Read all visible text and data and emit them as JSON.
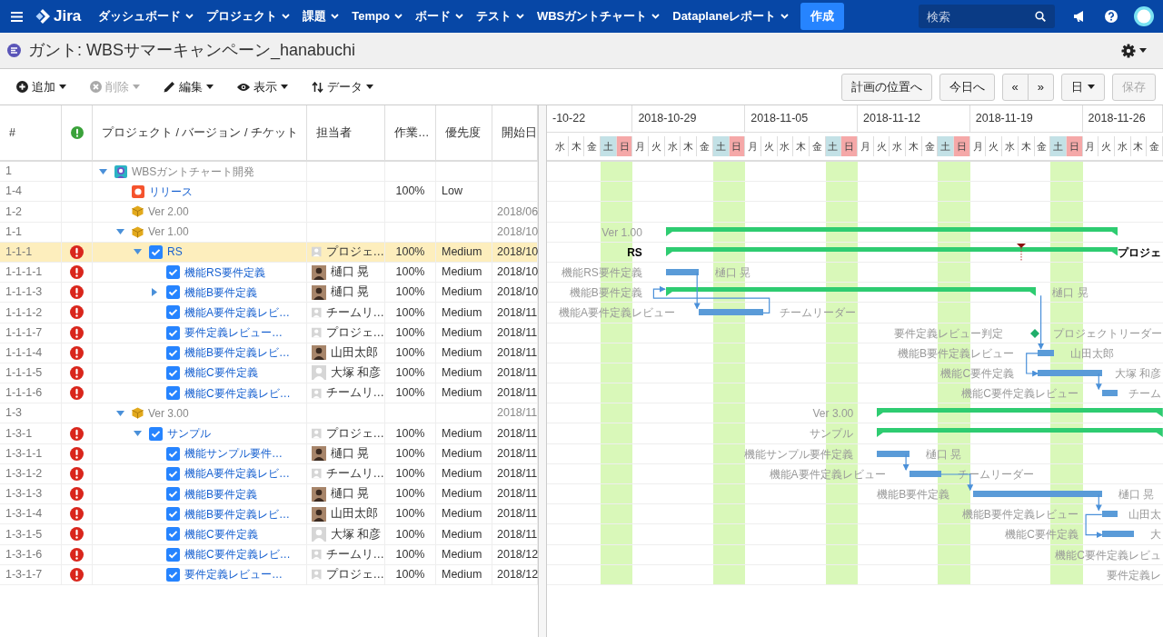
{
  "nav": {
    "app_name": "Jira",
    "menus": [
      {
        "label": "ダッシュボード"
      },
      {
        "label": "プロジェクト"
      },
      {
        "label": "課題"
      },
      {
        "label": "Tempo"
      },
      {
        "label": "ボード"
      },
      {
        "label": "テスト"
      },
      {
        "label": "WBSガントチャート"
      },
      {
        "label": "Dataplaneレポート"
      }
    ],
    "create_button": "作成",
    "search": {
      "placeholder": "検索"
    }
  },
  "page_title": "ガント: WBSサマーキャンペーン_hanabuchi",
  "toolbar": {
    "left": [
      {
        "label": "追加",
        "disabled": false
      },
      {
        "label": "削除",
        "disabled": true
      },
      {
        "label": "編集",
        "disabled": false
      },
      {
        "label": "表示",
        "disabled": false
      },
      {
        "label": "データ",
        "disabled": false
      }
    ],
    "right": [
      {
        "kind": "button",
        "label": "計画の位置へ",
        "disabled": false
      },
      {
        "kind": "button",
        "label": "今日へ",
        "disabled": false
      },
      {
        "kind": "pair",
        "labels": [
          "«",
          "»"
        ]
      },
      {
        "kind": "dropdown",
        "label": "日"
      },
      {
        "kind": "button",
        "label": "保存",
        "disabled": true
      }
    ]
  },
  "table": {
    "columns": [
      {
        "kind": "text",
        "label": "#"
      },
      {
        "kind": "alert"
      },
      {
        "kind": "text",
        "label": "プロジェクト / バージョン / チケット"
      },
      {
        "kind": "text",
        "label": "担当者"
      },
      {
        "kind": "text",
        "label": "作業…"
      },
      {
        "kind": "text",
        "label": "優先度"
      },
      {
        "kind": "text",
        "label": "開始日"
      }
    ],
    "rows": [
      {
        "id": "1",
        "kind": "project",
        "name": "WBSガントチャート開発",
        "alert": false,
        "selected": false,
        "expanded": true,
        "children": [
          {
            "id": "1-4",
            "kind": "release",
            "name": "リリース",
            "alert": false,
            "selected": false,
            "progress": "100%",
            "priority": "Low"
          },
          {
            "id": "1-2",
            "kind": "version",
            "name": "Ver 2.00",
            "alert": false,
            "selected": false,
            "start": "2018/06"
          },
          {
            "id": "1-1",
            "kind": "version",
            "name": "Ver 1.00",
            "alert": false,
            "selected": false,
            "start": "2018/10",
            "expanded": true,
            "gantt": {
              "label": "Ver 1.00",
              "kind": "summary"
            },
            "children": [
              {
                "id": "1-1-1",
                "kind": "task",
                "name": "RS",
                "alert": true,
                "selected": true,
                "expanded": true,
                "assignee": {
                  "name": "プロジェ…",
                  "kind": "default"
                },
                "progress": "100%",
                "priority": "Medium",
                "start": "2018/10",
                "gantt": {
                  "label": "RS",
                  "kind": "summary",
                  "assignee": "プロジェ",
                  "due_marker": true
                },
                "children": [
                  {
                    "id": "1-1-1-1",
                    "kind": "task",
                    "name": "機能RS要件定義",
                    "alert": true,
                    "selected": false,
                    "assignee": {
                      "name": "樋口 晃",
                      "kind": "photo"
                    },
                    "progress": "100%",
                    "priority": "Medium",
                    "start": "2018/10",
                    "gantt": {
                      "label": "機能RS要件定義",
                      "kind": "task",
                      "assignee": "樋口 晃"
                    }
                  },
                  {
                    "id": "1-1-1-3",
                    "kind": "task",
                    "name": "機能B要件定義",
                    "alert": true,
                    "selected": false,
                    "expanded": false,
                    "assignee": {
                      "name": "樋口 晃",
                      "kind": "photo"
                    },
                    "progress": "100%",
                    "priority": "Medium",
                    "start": "2018/10",
                    "gantt": {
                      "label": "機能B要件定義",
                      "kind": "summary",
                      "assignee": "樋口 晃"
                    }
                  },
                  {
                    "id": "1-1-1-2",
                    "kind": "task",
                    "name": "機能A要件定義レビ…",
                    "alert": true,
                    "selected": false,
                    "assignee": {
                      "name": "チームリ…",
                      "kind": "default"
                    },
                    "progress": "100%",
                    "priority": "Medium",
                    "start": "2018/11",
                    "gantt": {
                      "label": "機能A要件定義レビュー",
                      "kind": "task",
                      "assignee": "チームリーダー"
                    }
                  },
                  {
                    "id": "1-1-1-7",
                    "kind": "task",
                    "name": "要件定義レビュー…",
                    "alert": true,
                    "selected": false,
                    "assignee": {
                      "name": "プロジェ…",
                      "kind": "default"
                    },
                    "progress": "100%",
                    "priority": "Medium",
                    "start": "2018/11",
                    "gantt": {
                      "label": "要件定義レビュー判定",
                      "kind": "milestone",
                      "assignee": "プロジェクトリーダー"
                    }
                  },
                  {
                    "id": "1-1-1-4",
                    "kind": "task",
                    "name": "機能B要件定義レビ…",
                    "alert": true,
                    "selected": false,
                    "assignee": {
                      "name": "山田太郎",
                      "kind": "photo"
                    },
                    "progress": "100%",
                    "priority": "Medium",
                    "start": "2018/11",
                    "gantt": {
                      "label": "機能B要件定義レビュー",
                      "kind": "task",
                      "assignee": "山田太郎"
                    }
                  },
                  {
                    "id": "1-1-1-5",
                    "kind": "task",
                    "name": "機能C要件定義",
                    "alert": true,
                    "selected": false,
                    "assignee": {
                      "name": "大塚 和彦",
                      "kind": "default"
                    },
                    "progress": "100%",
                    "priority": "Medium",
                    "start": "2018/11",
                    "gantt": {
                      "label": "機能C要件定義",
                      "kind": "task",
                      "assignee": "大塚 和彦"
                    }
                  },
                  {
                    "id": "1-1-1-6",
                    "kind": "task",
                    "name": "機能C要件定義レビ…",
                    "alert": true,
                    "selected": false,
                    "assignee": {
                      "name": "チームリ…",
                      "kind": "default"
                    },
                    "progress": "100%",
                    "priority": "Medium",
                    "start": "2018/11",
                    "gantt": {
                      "label": "機能C要件定義レビュー",
                      "kind": "task",
                      "assignee": "チーム"
                    }
                  }
                ]
              }
            ]
          },
          {
            "id": "1-3",
            "kind": "version",
            "name": "Ver 3.00",
            "alert": false,
            "selected": false,
            "start": "2018/11",
            "expanded": true,
            "gantt": {
              "label": "Ver 3.00",
              "kind": "summary"
            },
            "children": [
              {
                "id": "1-3-1",
                "kind": "task",
                "name": "サンプル",
                "alert": true,
                "selected": false,
                "expanded": true,
                "assignee": {
                  "name": "プロジェ…",
                  "kind": "default"
                },
                "progress": "100%",
                "priority": "Medium",
                "start": "2018/11",
                "gantt": {
                  "label": "サンプル",
                  "kind": "summary"
                },
                "children": [
                  {
                    "id": "1-3-1-1",
                    "kind": "task",
                    "name": "機能サンプル要件…",
                    "alert": true,
                    "selected": false,
                    "assignee": {
                      "name": "樋口 晃",
                      "kind": "photo"
                    },
                    "progress": "100%",
                    "priority": "Medium",
                    "start": "2018/11",
                    "gantt": {
                      "label": "機能サンプル要件定義",
                      "kind": "task",
                      "assignee": "樋口 晃"
                    }
                  },
                  {
                    "id": "1-3-1-2",
                    "kind": "task",
                    "name": "機能A要件定義レビ…",
                    "alert": true,
                    "selected": false,
                    "assignee": {
                      "name": "チームリ…",
                      "kind": "default"
                    },
                    "progress": "100%",
                    "priority": "Medium",
                    "start": "2018/11",
                    "gantt": {
                      "label": "機能A要件定義レビュー",
                      "kind": "task",
                      "assignee": "チームリーダー"
                    }
                  },
                  {
                    "id": "1-3-1-3",
                    "kind": "task",
                    "name": "機能B要件定義",
                    "alert": true,
                    "selected": false,
                    "assignee": {
                      "name": "樋口 晃",
                      "kind": "photo"
                    },
                    "progress": "100%",
                    "priority": "Medium",
                    "start": "2018/11",
                    "gantt": {
                      "label": "機能B要件定義",
                      "kind": "task",
                      "assignee": "樋口 晃"
                    }
                  },
                  {
                    "id": "1-3-1-4",
                    "kind": "task",
                    "name": "機能B要件定義レビ…",
                    "alert": true,
                    "selected": false,
                    "assignee": {
                      "name": "山田太郎",
                      "kind": "photo"
                    },
                    "progress": "100%",
                    "priority": "Medium",
                    "start": "2018/11",
                    "gantt": {
                      "label": "機能B要件定義レビュー",
                      "kind": "task",
                      "assignee": "山田太"
                    }
                  },
                  {
                    "id": "1-3-1-5",
                    "kind": "task",
                    "name": "機能C要件定義",
                    "alert": true,
                    "selected": false,
                    "assignee": {
                      "name": "大塚 和彦",
                      "kind": "default"
                    },
                    "progress": "100%",
                    "priority": "Medium",
                    "start": "2018/11",
                    "gantt": {
                      "label": "機能C要件定義",
                      "kind": "task",
                      "assignee": "大"
                    }
                  },
                  {
                    "id": "1-3-1-6",
                    "kind": "task",
                    "name": "機能C要件定義レビ…",
                    "alert": true,
                    "selected": false,
                    "assignee": {
                      "name": "チームリ…",
                      "kind": "default"
                    },
                    "progress": "100%",
                    "priority": "Medium",
                    "start": "2018/12",
                    "gantt": {
                      "label": "機能C要件定義レビュ"
                    }
                  },
                  {
                    "id": "1-3-1-7",
                    "kind": "task",
                    "name": "要件定義レビュー…",
                    "alert": true,
                    "selected": false,
                    "assignee": {
                      "name": "プロジェ…",
                      "kind": "default"
                    },
                    "progress": "100%",
                    "priority": "Medium",
                    "start": "2018/12",
                    "gantt": {
                      "label": "要件定義レ"
                    }
                  }
                ]
              }
            ]
          }
        ]
      }
    ]
  },
  "gantt": {
    "weeks": [
      {
        "label": "-10-22",
        "days": [
          {
            "label": "水",
            "kind": "weekday"
          },
          {
            "label": "木",
            "kind": "weekday"
          },
          {
            "label": "金",
            "kind": "weekday"
          },
          {
            "label": "土",
            "kind": "sat"
          },
          {
            "label": "日",
            "kind": "sun"
          }
        ]
      },
      {
        "label": "2018-10-29",
        "days": [
          {
            "label": "月",
            "kind": "weekday"
          },
          {
            "label": "火",
            "kind": "weekday"
          },
          {
            "label": "水",
            "kind": "weekday"
          },
          {
            "label": "木",
            "kind": "weekday"
          },
          {
            "label": "金",
            "kind": "weekday"
          },
          {
            "label": "土",
            "kind": "sat"
          },
          {
            "label": "日",
            "kind": "sun"
          }
        ]
      },
      {
        "label": "2018-11-05",
        "days": [
          {
            "label": "月",
            "kind": "weekday"
          },
          {
            "label": "火",
            "kind": "weekday"
          },
          {
            "label": "水",
            "kind": "weekday"
          },
          {
            "label": "木",
            "kind": "weekday"
          },
          {
            "label": "金",
            "kind": "weekday"
          },
          {
            "label": "土",
            "kind": "sat"
          },
          {
            "label": "日",
            "kind": "sun"
          }
        ]
      },
      {
        "label": "2018-11-12",
        "days": [
          {
            "label": "月",
            "kind": "weekday"
          },
          {
            "label": "火",
            "kind": "weekday"
          },
          {
            "label": "水",
            "kind": "weekday"
          },
          {
            "label": "木",
            "kind": "weekday"
          },
          {
            "label": "金",
            "kind": "weekday"
          },
          {
            "label": "土",
            "kind": "sat"
          },
          {
            "label": "日",
            "kind": "sun"
          }
        ]
      },
      {
        "label": "2018-11-19",
        "days": [
          {
            "label": "月",
            "kind": "weekday"
          },
          {
            "label": "火",
            "kind": "weekday"
          },
          {
            "label": "水",
            "kind": "weekday"
          },
          {
            "label": "木",
            "kind": "weekday"
          },
          {
            "label": "金",
            "kind": "weekday"
          },
          {
            "label": "土",
            "kind": "sat"
          },
          {
            "label": "日",
            "kind": "sun"
          }
        ]
      },
      {
        "label": "2018-11-26",
        "days": [
          {
            "label": "月",
            "kind": "weekday"
          },
          {
            "label": "火",
            "kind": "weekday"
          },
          {
            "label": "水",
            "kind": "weekday"
          },
          {
            "label": "木",
            "kind": "weekday"
          },
          {
            "label": "金",
            "kind": "weekday"
          }
        ]
      }
    ]
  }
}
